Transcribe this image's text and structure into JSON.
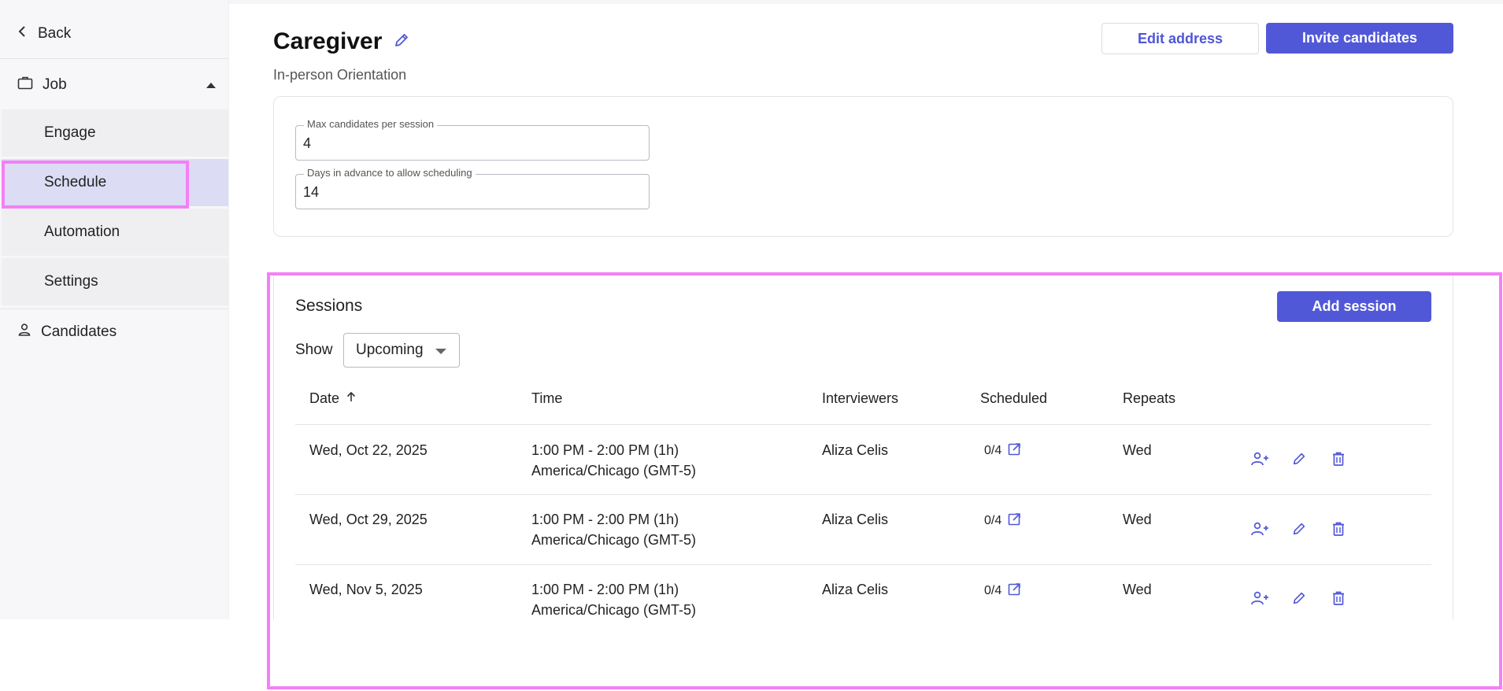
{
  "sidebar": {
    "back_label": "Back",
    "job_label": "Job",
    "items": [
      {
        "label": "Engage",
        "active": false
      },
      {
        "label": "Schedule",
        "active": true
      },
      {
        "label": "Automation",
        "active": false
      },
      {
        "label": "Settings",
        "active": false
      }
    ],
    "candidates_label": "Candidates"
  },
  "header": {
    "title": "Caregiver",
    "subtitle": "In-person Orientation",
    "edit_address_label": "Edit address",
    "invite_label": "Invite candidates"
  },
  "settings": {
    "max_candidates": {
      "label": "Max candidates per session",
      "value": "4"
    },
    "days_advance": {
      "label": "Days in advance to allow scheduling",
      "value": "14"
    }
  },
  "sessions": {
    "title": "Sessions",
    "add_label": "Add session",
    "show_label": "Show",
    "filter_value": "Upcoming",
    "columns": {
      "date": "Date",
      "time": "Time",
      "interviewers": "Interviewers",
      "scheduled": "Scheduled",
      "repeats": "Repeats"
    },
    "rows": [
      {
        "date": "Wed, Oct 22, 2025",
        "time": "1:00 PM - 2:00 PM (1h)",
        "timezone": "America/Chicago (GMT-5)",
        "interviewer": "Aliza Celis",
        "scheduled": "0/4",
        "repeats": "Wed"
      },
      {
        "date": "Wed, Oct 29, 2025",
        "time": "1:00 PM - 2:00 PM (1h)",
        "timezone": "America/Chicago (GMT-5)",
        "interviewer": "Aliza Celis",
        "scheduled": "0/4",
        "repeats": "Wed"
      },
      {
        "date": "Wed, Nov 5, 2025",
        "time": "1:00 PM - 2:00 PM (1h)",
        "timezone": "America/Chicago (GMT-5)",
        "interviewer": "Aliza Celis",
        "scheduled": "0/4",
        "repeats": "Wed"
      }
    ]
  },
  "colors": {
    "accent": "#5158d8",
    "highlight": "#f47ff6",
    "active_nav": "#dcdcf5"
  }
}
